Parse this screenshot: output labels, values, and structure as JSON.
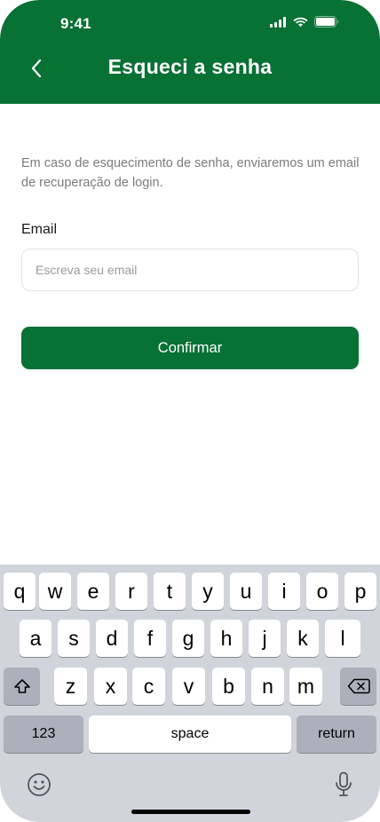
{
  "status_bar": {
    "time": "9:41"
  },
  "header": {
    "title": "Esqueci a senha",
    "back_icon": "chevron-left-icon"
  },
  "main": {
    "description": "Em caso de esquecimento de senha, enviaremos um email de recuperação de login.",
    "email_label": "Email",
    "email_placeholder": "Escreva seu email",
    "email_value": "",
    "confirm_label": "Confirmar"
  },
  "keyboard": {
    "row1": [
      "q",
      "w",
      "e",
      "r",
      "t",
      "y",
      "u",
      "i",
      "o",
      "p"
    ],
    "row2": [
      "a",
      "s",
      "d",
      "f",
      "g",
      "h",
      "j",
      "k",
      "l"
    ],
    "row3": [
      "z",
      "x",
      "c",
      "v",
      "b",
      "n",
      "m"
    ],
    "numbers_label": "123",
    "space_label": "space",
    "return_label": "return",
    "shift_icon": "shift-icon",
    "delete_icon": "delete-icon",
    "emoji_icon": "emoji-icon",
    "mic_icon": "microphone-icon"
  },
  "colors": {
    "brand": "#087134",
    "keyboard_bg": "#d1d4db",
    "special_key": "#abb0bb"
  }
}
